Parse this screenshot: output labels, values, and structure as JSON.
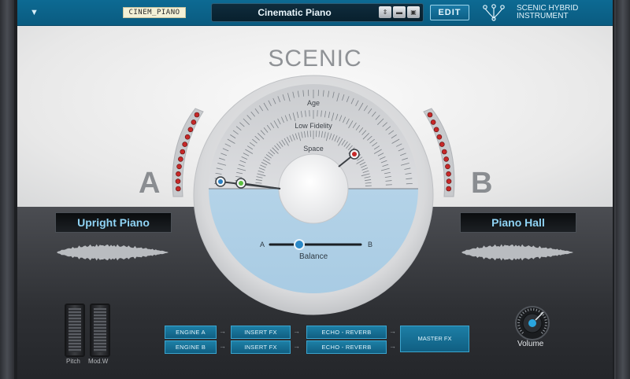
{
  "header": {
    "preset_tag": "CINEM_PIANO",
    "preset_name": "Cinematic Piano",
    "edit_label": "EDIT",
    "brand_line1": "SCENIC HYBRID",
    "brand_line2": "INSTRUMENT"
  },
  "main": {
    "title": "SCENIC",
    "side_a": "A",
    "side_b": "B",
    "display_a": "Upright Piano",
    "display_b": "Piano Hall",
    "dial_labels": [
      "Age",
      "Low Fidelity",
      "Space"
    ],
    "balance": {
      "label": "Balance",
      "left": "A",
      "right": "B"
    }
  },
  "controls": {
    "pitch_label": "Pitch",
    "mod_label": "Mod.W",
    "volume_label": "Volume"
  },
  "routing": {
    "engine_a": "ENGINE A",
    "engine_b": "ENGINE B",
    "insert_fx": "INSERT FX",
    "echo_reverb": "ECHO - REVERB",
    "master_fx": "MASTER FX"
  },
  "colors": {
    "header": "#0d6a93",
    "display_text": "#8fd3f4",
    "dial_lower": "#b7d6ea",
    "led_red": "#c62828"
  },
  "icons": {
    "menu": "menu-arrow-icon",
    "up_down": "up-down-arrows-icon",
    "folder": "folder-icon",
    "save": "save-icon",
    "brand": "scenic-logo-icon"
  }
}
